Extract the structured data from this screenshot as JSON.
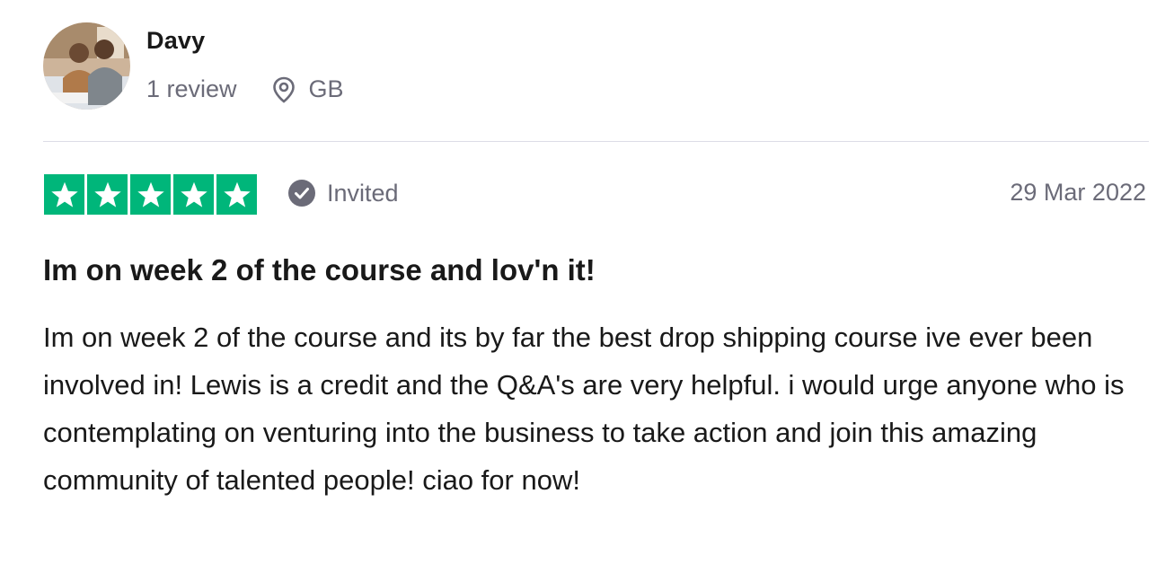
{
  "reviewer": {
    "name": "Davy",
    "review_count": "1 review",
    "location": "GB",
    "avatar_icon": "avatar-photo"
  },
  "review": {
    "rating": 5,
    "rating_max": 5,
    "star_color": "#00b67a",
    "verification_label": "Invited",
    "verification_icon": "check-badge-icon",
    "date": "29 Mar 2022",
    "title": "Im on week 2 of the course and lov'n it!",
    "body": "Im on week 2 of the course and its by far the best drop shipping course ive ever been involved in! Lewis is a credit and the Q&A's are very helpful. i would urge anyone who is contemplating on venturing into the business to take action and join this amazing community of talented people! ciao for now!"
  },
  "colors": {
    "text_primary": "#191919",
    "text_secondary": "#6b6b78",
    "divider": "#dcdce6",
    "star_green": "#00b67a"
  }
}
